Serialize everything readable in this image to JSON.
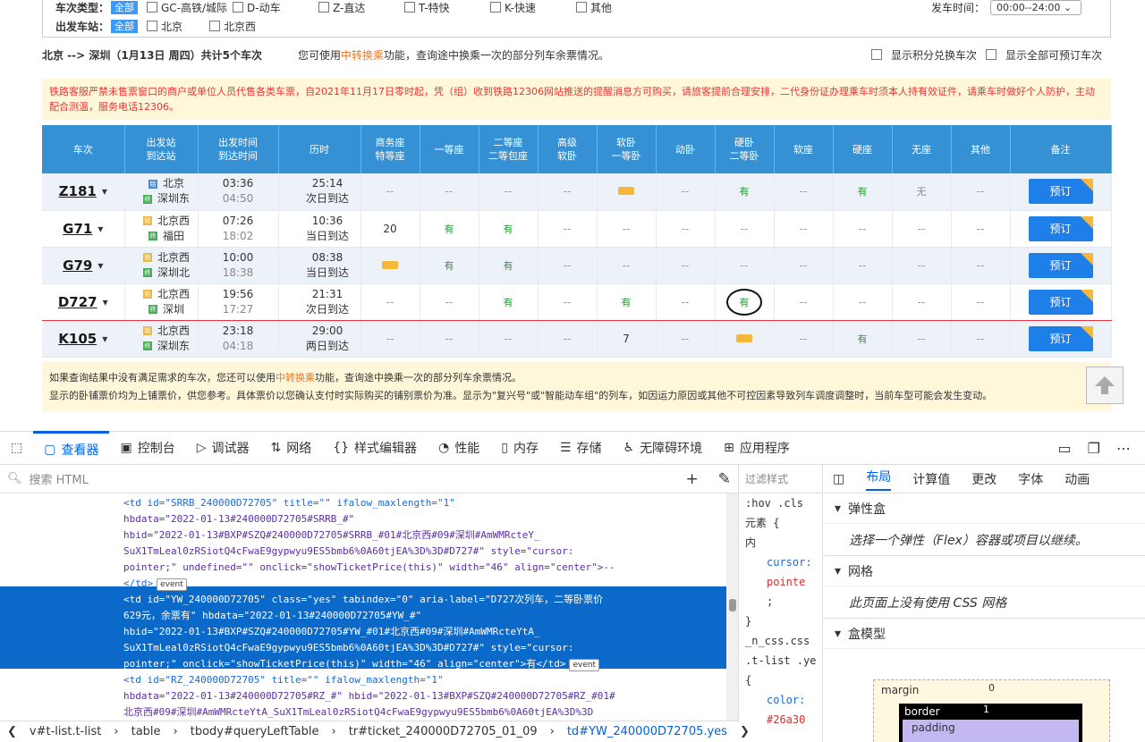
{
  "filter": {
    "type_label": "车次类型：",
    "all_label": "全部",
    "types": [
      "GC-高铁/城际",
      "D-动车",
      "Z-直达",
      "T-特快",
      "K-快速",
      "其他"
    ],
    "station_label": "出发车站：",
    "stations": [
      "北京",
      "北京西"
    ],
    "time_label": "发车时间：",
    "time_value": "00:00--24:00"
  },
  "summary": {
    "route": "北京 --> 深圳（1月13日 周四）共计5个车次",
    "hint_pre": "您可使用",
    "hint_link": "中转换乘",
    "hint_post": "功能，查询途中换乘一次的部分列车余票情况。",
    "opt1": "显示积分兑换车次",
    "opt2": "显示全部可预订车次"
  },
  "notice": "铁路客服严禁未售票窗口的商户或单位人员代售各类车票，自2021年11月17日零时起，凭（组）收到铁路12306网站推送的提醒消息方可购买，请旅客提前合理安排，二代身份证办理乘车时须本人持有效证件，请乘车时做好个人防护，主动配合测温，服务电话12306。",
  "headers": [
    "车次",
    "出发站\n到达站",
    "出发时间\n到达时间",
    "历时",
    "商务座\n特等座",
    "一等座",
    "二等座\n二等包座",
    "高级\n软卧",
    "软卧\n一等卧",
    "动卧",
    "硬卧\n二等卧",
    "软座",
    "硬座",
    "无座",
    "其他",
    "备注"
  ],
  "book_label": "预订",
  "trains": [
    {
      "no": "Z181",
      "from": "北京",
      "to": "深圳东",
      "dep": "03:36",
      "arr": "04:50",
      "dur": "25:14",
      "day": "次日到达",
      "seats": [
        "--",
        "--",
        "--",
        "--",
        "候",
        "--",
        "有",
        "--",
        "有",
        "无",
        "--"
      ]
    },
    {
      "no": "G71",
      "from": "北京西",
      "to": "福田",
      "dep": "07:26",
      "arr": "18:02",
      "dur": "10:36",
      "day": "当日到达",
      "seats": [
        "20",
        "有",
        "有",
        "--",
        "--",
        "--",
        "--",
        "--",
        "--",
        "--",
        "--"
      ]
    },
    {
      "no": "G79",
      "from": "北京西",
      "to": "深圳北",
      "dep": "10:00",
      "arr": "18:38",
      "dur": "08:38",
      "day": "当日到达",
      "seats": [
        "候",
        "有",
        "有",
        "--",
        "--",
        "--",
        "--",
        "--",
        "--",
        "--",
        "--"
      ]
    },
    {
      "no": "D727",
      "from": "北京西",
      "to": "深圳",
      "dep": "19:56",
      "arr": "17:27",
      "dur": "21:31",
      "day": "次日到达",
      "seats": [
        "--",
        "--",
        "有",
        "--",
        "有",
        "--",
        "有",
        "--",
        "--",
        "--",
        "--"
      ]
    },
    {
      "no": "K105",
      "from": "北京西",
      "to": "深圳东",
      "dep": "23:18",
      "arr": "04:18",
      "dur": "29:00",
      "day": "两日到达",
      "seats": [
        "--",
        "--",
        "--",
        "--",
        "7",
        "--",
        "候",
        "--",
        "有",
        "--",
        "--"
      ]
    }
  ],
  "foot": {
    "line1_pre": "如果查询结果中没有满足需求的车次，您还可以使用",
    "line1_link": "中转换乘",
    "line1_post": "功能，查询途中换乘一次的部分列车余票情况。",
    "line2": "显示的卧铺票价均为上铺票价，供您参考。具体票价以您确认支付时实际购买的铺别票价为准。显示为\"复兴号\"或\"智能动车组\"的列车，如因运力原因或其他不可控因素导致列车调度调整时，当前车型可能会发生变动。"
  },
  "devtools": {
    "tabs": [
      "查看器",
      "控制台",
      "调试器",
      "网络",
      "样式编辑器",
      "性能",
      "内存",
      "存储",
      "无障碍环境",
      "应用程序"
    ],
    "search_placeholder": "搜索 HTML",
    "code": [
      "<td id=\"SRRB_240000D72705\" title=\"\" ifalow_maxlength=\"1\"",
      "hbdata=\"2022-01-13#240000D72705#SRRB_#\"",
      "hbid=\"2022-01-13#BXP#SZQ#240000D72705#SRRB_#01#北京西#09#深圳#AmWMRcteY_",
      "SuX1TmLeal0zRSiotQ4cFwaE9gypwyu9ES5bmb6%0A60tjEA%3D%3D#D727#\" style=\"cursor:",
      "pointer;\" undefined=\"\" onclick=\"showTicketPrice(this)\" width=\"46\" align=\"center\">--",
      "</td>",
      "<td id=\"YW_240000D72705\" class=\"yes\" tabindex=\"0\" aria-label=\"D727次列车，二等卧票价",
      "629元，余票有\" hbdata=\"2022-01-13#240000D72705#YW_#\"",
      "hbid=\"2022-01-13#BXP#SZQ#240000D72705#YW_#01#北京西#09#深圳#AmWMRcteYtA_",
      "SuX1TmLeal0zRSiotQ4cFwaE9gypwyu9ES5bmb6%0A60tjEA%3D%3D#D727#\" style=\"cursor:",
      "pointer;\" onclick=\"showTicketPrice(this)\" width=\"46\" align=\"center\">有</td>",
      "<td id=\"RZ_240000D72705\" title=\"\" ifalow_maxlength=\"1\"",
      "hbdata=\"2022-01-13#240000D72705#RZ_#\" hbid=\"2022-01-13#BXP#SZQ#240000D72705#RZ_#01#",
      "北京西#09#深圳#AmWMRcteYtA_SuX1TmLeal0zRSiotQ4cFwaE9gypwyu9ES5bmb6%0A60tjEA%3D%3D"
    ],
    "event": "event",
    "crumbs": [
      "v#t-list.t-list",
      "table",
      "tbody#queryLeftTable",
      "tr#ticket_240000D72705_01_09",
      "td#YW_240000D72705.yes"
    ],
    "mid": [
      "过滤样式",
      ":hov .cls",
      "元素 {",
      "内",
      "cursor:",
      "pointe",
      ";",
      "}",
      "_n_css.css",
      ".t-list .ye",
      "{",
      "color:",
      "#26a30"
    ],
    "rtabs": [
      "布局",
      "计算值",
      "更改",
      "字体",
      "动画"
    ],
    "flex_title": "弹性盒",
    "flex_body": "选择一个弹性（Flex）容器或项目以继续。",
    "grid_title": "网格",
    "grid_body": "此页面上没有使用 CSS 网格",
    "box_title": "盒模型",
    "box_margin": "margin",
    "box_margin_val": "0",
    "box_border": "border",
    "box_border_val": "1",
    "box_padding": "padding"
  }
}
